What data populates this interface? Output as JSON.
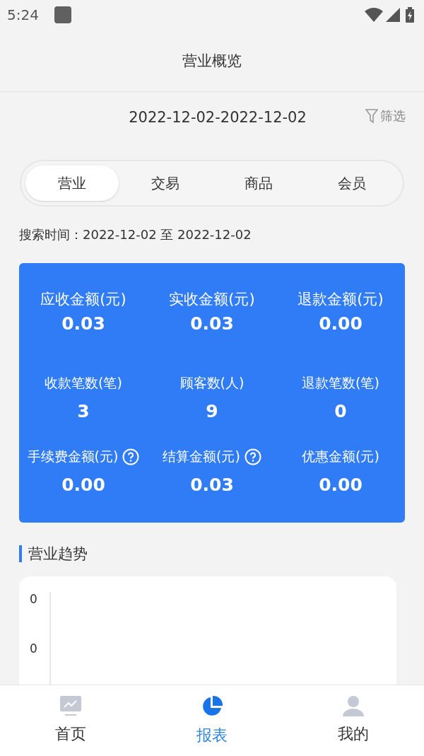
{
  "status_bar": {
    "time": "5:24"
  },
  "header": {
    "title": "营业概览"
  },
  "date_range": {
    "text": "2022-12-02-2022-12-02",
    "filter_label": "筛选"
  },
  "tabs": [
    {
      "label": "营业",
      "selected": true
    },
    {
      "label": "交易",
      "selected": false
    },
    {
      "label": "商品",
      "selected": false
    },
    {
      "label": "会员",
      "selected": false
    }
  ],
  "search_time": "搜索时间：2022-12-02 至 2022-12-02",
  "metrics": [
    {
      "label": "应收金额(元)",
      "value": "0.03",
      "help": false,
      "large": true
    },
    {
      "label": "实收金额(元)",
      "value": "0.03",
      "help": false,
      "large": true
    },
    {
      "label": "退款金额(元)",
      "value": "0.00",
      "help": false,
      "large": true
    },
    {
      "label": "收款笔数(笔)",
      "value": "3",
      "help": false,
      "large": false
    },
    {
      "label": "顾客数(人)",
      "value": "9",
      "help": false,
      "large": false
    },
    {
      "label": "退款笔数(笔)",
      "value": "0",
      "help": false,
      "large": false
    },
    {
      "label": "手续费金额(元)",
      "value": "0.00",
      "help": true,
      "large": false
    },
    {
      "label": "结算金额(元)",
      "value": "0.03",
      "help": true,
      "large": false
    },
    {
      "label": "优惠金额(元)",
      "value": "0.00",
      "help": false,
      "large": false
    }
  ],
  "trend": {
    "title": "营业趋势",
    "y_labels": [
      "0",
      "0"
    ]
  },
  "bottom_nav": [
    {
      "label": "首页",
      "kind": "home",
      "selected": false
    },
    {
      "label": "报表",
      "kind": "report",
      "selected": true
    },
    {
      "label": "我的",
      "kind": "profile",
      "selected": false
    }
  ]
}
